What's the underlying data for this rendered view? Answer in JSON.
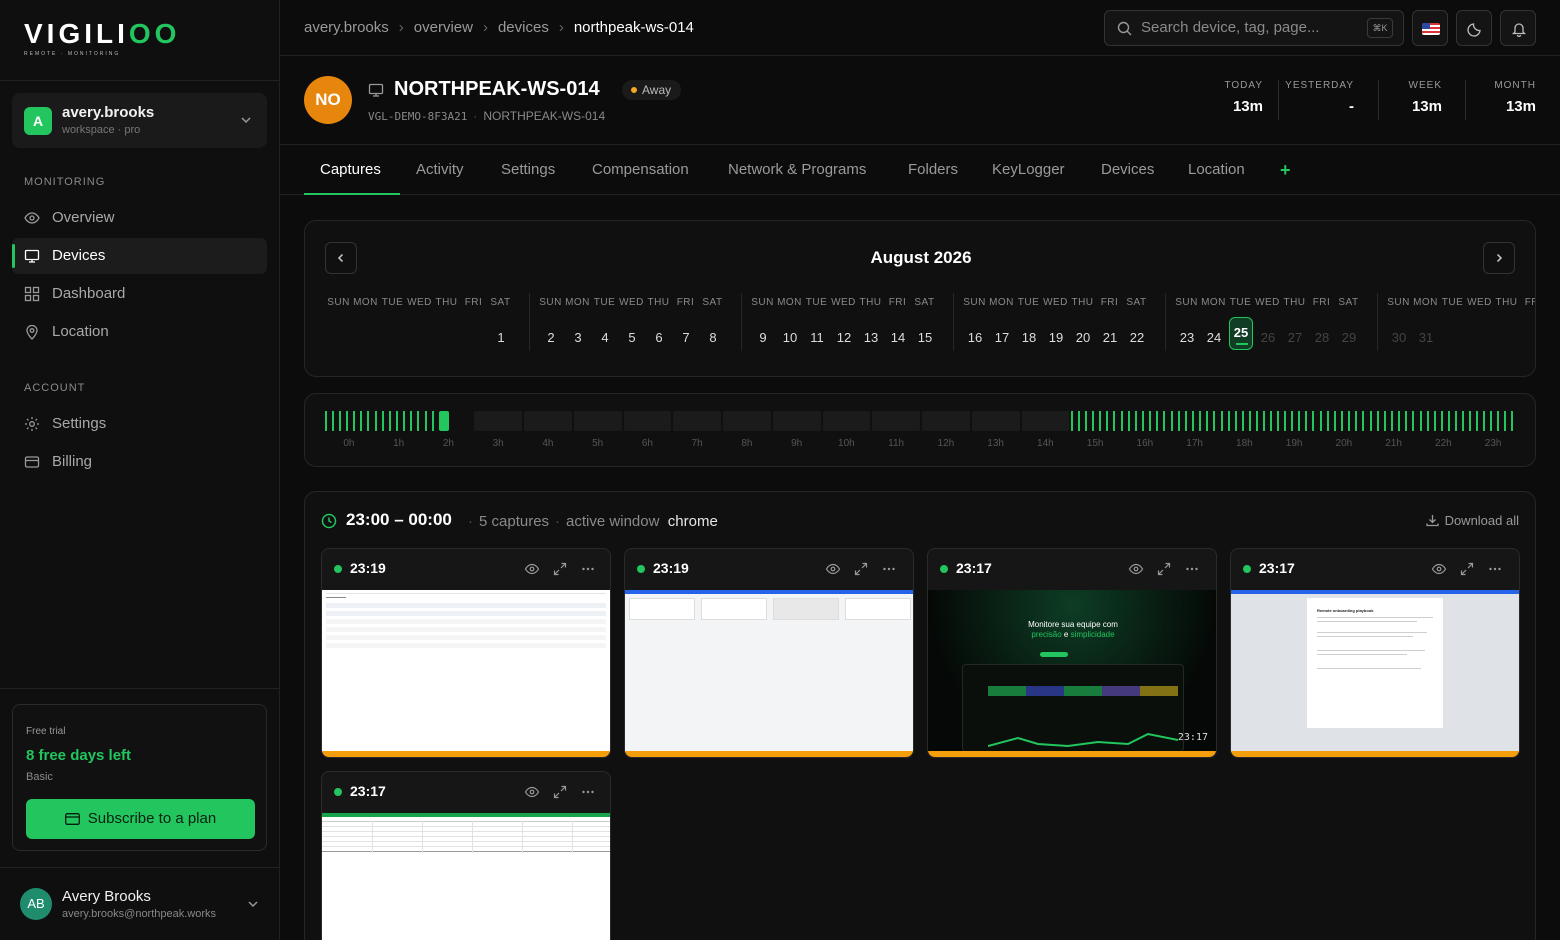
{
  "brand": {
    "word_main": "VIGILI",
    "word_accent": "OO",
    "tagline": "REMOTE · MONITORING"
  },
  "workspace": {
    "initial": "A",
    "name": "avery.brooks",
    "plan": "workspace · pro"
  },
  "sidebar": {
    "monitoring_label": "MONITORING",
    "monitoring": [
      {
        "label": "Overview",
        "icon": "eye-icon"
      },
      {
        "label": "Devices",
        "icon": "monitor-icon",
        "active": true
      },
      {
        "label": "Dashboard",
        "icon": "grid-icon"
      },
      {
        "label": "Location",
        "icon": "pin-icon"
      }
    ],
    "account_label": "ACCOUNT",
    "account": [
      {
        "label": "Settings",
        "icon": "gear-icon"
      },
      {
        "label": "Billing",
        "icon": "card-icon"
      }
    ]
  },
  "trial": {
    "label": "Free trial",
    "days": "8 free days left",
    "plan": "Basic",
    "cta": "Subscribe to a plan"
  },
  "user": {
    "initials": "AB",
    "name": "Avery Brooks",
    "email": "avery.brooks@northpeak.works"
  },
  "breadcrumb": [
    "avery.brooks",
    "overview",
    "devices",
    "northpeak-ws-014"
  ],
  "search": {
    "placeholder": "Search device, tag, page...",
    "shortcut": "⌘K"
  },
  "device": {
    "initials": "NO",
    "name": "NORTHPEAK-WS-014",
    "status": "Away",
    "status_color": "#f5a623",
    "id": "VGL-DEMO-8F3A21",
    "host": "NORTHPEAK-WS-014"
  },
  "stats": [
    {
      "label": "TODAY",
      "value": "13m"
    },
    {
      "label": "YESTERDAY",
      "value": "-"
    },
    {
      "label": "WEEK",
      "value": "13m"
    },
    {
      "label": "MONTH",
      "value": "13m"
    }
  ],
  "tabs": [
    "Captures",
    "Activity",
    "Settings",
    "Compensation",
    "Network & Programs",
    "Folders",
    "KeyLogger",
    "Devices",
    "Location"
  ],
  "tab_add": "+",
  "calendar": {
    "title": "August 2026",
    "dow": [
      "SUN",
      "MON",
      "TUE",
      "WED",
      "THU",
      "FRI",
      "SAT"
    ],
    "weeks": [
      [
        "",
        "",
        "",
        "",
        "",
        "",
        "1"
      ],
      [
        "2",
        "3",
        "4",
        "5",
        "6",
        "7",
        "8"
      ],
      [
        "9",
        "10",
        "11",
        "12",
        "13",
        "14",
        "15"
      ],
      [
        "16",
        "17",
        "18",
        "19",
        "20",
        "21",
        "22"
      ],
      [
        "23",
        "24",
        "25",
        "26",
        "27",
        "28",
        "29"
      ],
      [
        "30",
        "31",
        "",
        "",
        "",
        "",
        ""
      ]
    ],
    "selected": "25",
    "last_active": "25"
  },
  "timeline": {
    "hours": [
      "0h",
      "1h",
      "2h",
      "3h",
      "4h",
      "5h",
      "6h",
      "7h",
      "8h",
      "9h",
      "10h",
      "11h",
      "12h",
      "13h",
      "14h",
      "15h",
      "16h",
      "17h",
      "18h",
      "19h",
      "20h",
      "21h",
      "22h",
      "23h"
    ],
    "active_hours": [
      0,
      1,
      2,
      15,
      16,
      17,
      18,
      19,
      20,
      21,
      22,
      23
    ],
    "accent": "#22c55e"
  },
  "captures": {
    "range": "23:00 – 00:00",
    "count": "5 captures",
    "window_label": "active window",
    "window_app": "chrome",
    "download": "Download all",
    "items": [
      {
        "time": "23:19",
        "kind": "list"
      },
      {
        "time": "23:19",
        "kind": "board"
      },
      {
        "time": "23:17",
        "kind": "landing",
        "stamp": "23:17",
        "hero_line1": "Monitore sua equipe com",
        "hero_line2a": "precisão",
        "hero_line2b": " e ",
        "hero_line2c": "simplicidade"
      },
      {
        "time": "23:17",
        "kind": "doc",
        "doc_title": "Remote onboarding playbook"
      },
      {
        "time": "23:17",
        "kind": "sheet"
      }
    ]
  }
}
